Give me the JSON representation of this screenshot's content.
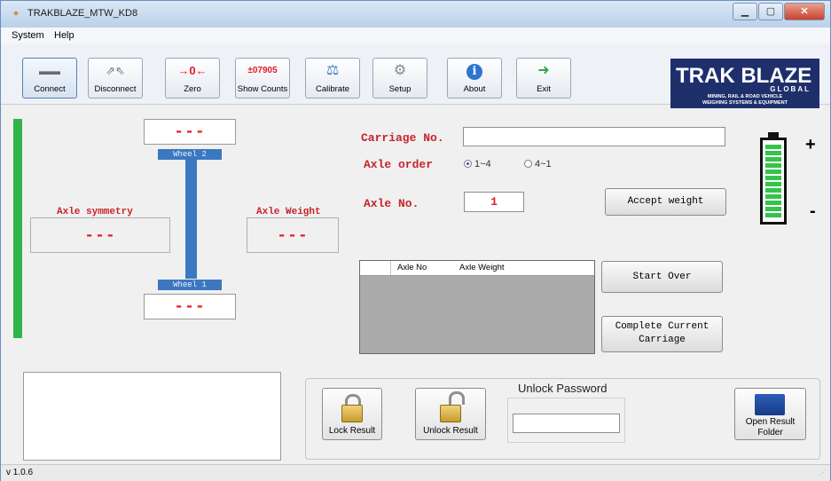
{
  "window": {
    "title": "TRAKBLAZE_MTW_KD8",
    "version": "v 1.0.6"
  },
  "menu": [
    "System",
    "Help"
  ],
  "toolbar": [
    {
      "name": "connect-button",
      "icon": "connect-icon",
      "glyph": "▬▬",
      "label": "Connect"
    },
    {
      "name": "disconnect-button",
      "icon": "disconnect-icon",
      "glyph": "⇗⇖",
      "label": "Disconnect"
    },
    {
      "name": "zero-button",
      "icon": "zero-icon",
      "glyph": "→0←",
      "label": "Zero"
    },
    {
      "name": "show-counts-button",
      "icon": "counts-icon",
      "glyph": "±07905",
      "label": "Show Counts"
    },
    {
      "name": "calibrate-button",
      "icon": "scale-icon",
      "glyph": "⚖",
      "label": "Calibrate"
    },
    {
      "name": "setup-button",
      "icon": "setup-icon",
      "glyph": "⚙",
      "label": "Setup"
    },
    {
      "name": "about-button",
      "icon": "info-icon",
      "glyph": "i",
      "label": "About"
    },
    {
      "name": "exit-button",
      "icon": "exit-icon",
      "glyph": "➜",
      "label": "Exit"
    }
  ],
  "logo": {
    "brand": "TRAK BLAZE",
    "sub": "GLOBAL",
    "tagline1": "MINING, RAIL & ROAD VEHICLE",
    "tagline2": "WEIGHING SYSTEMS & EQUIPMENT"
  },
  "axle_display": {
    "wheel2_value": "---",
    "wheel2_label": "Wheel 2",
    "wheel1_value": "---",
    "wheel1_label": "Wheel 1",
    "symmetry_label": "Axle symmetry",
    "symmetry_value": "---",
    "weight_label": "Axle Weight",
    "weight_value": "---"
  },
  "form": {
    "carriage_label": "Carriage No.",
    "carriage_value": "",
    "axle_order_label": "Axle order",
    "order_option1": "1~4",
    "order_option2": "4~1",
    "order_selected": "1~4",
    "axle_no_label": "Axle No.",
    "axle_no_value": "1",
    "accept_label": "Accept weight",
    "start_over_label": "Start Over",
    "complete_label_1": "Complete Current",
    "complete_label_2": "Carriage"
  },
  "grid": {
    "columns": [
      "Axle No",
      "Axle Weight"
    ],
    "rows": []
  },
  "battery": {
    "plus": "+",
    "minus": "-",
    "level": 1.0
  },
  "bottom": {
    "lock_label": "Lock Result",
    "unlock_label": "Unlock Result",
    "password_label": "Unlock Password",
    "password_value": "",
    "open_folder_1": "Open Result",
    "open_folder_2": "Folder"
  },
  "colors": {
    "accent_red": "#e31b23",
    "wheel_blue": "#3c78c0",
    "battery_green": "#33c44a",
    "status_green": "#2fb44a"
  }
}
